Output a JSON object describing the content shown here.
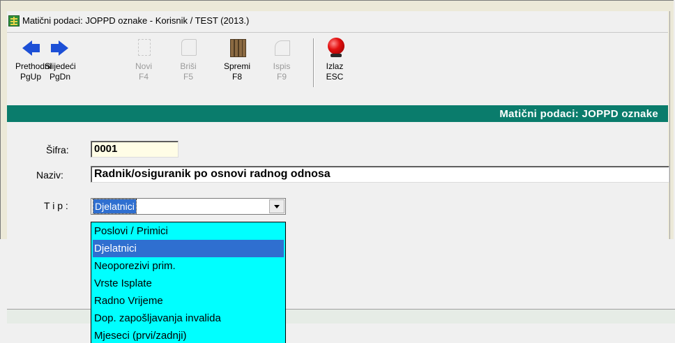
{
  "window": {
    "title": "Matični podaci: JOPPD oznake - Korisnik / TEST (2013.)"
  },
  "toolbar": {
    "buttons": [
      {
        "name": "prev",
        "line1": "Prethodni",
        "line2": "PgUp",
        "icon": "arrow-left-icon",
        "enabled": true
      },
      {
        "name": "next",
        "line1": "Slijedeći",
        "line2": "PgDn",
        "icon": "arrow-right-icon",
        "enabled": true
      },
      {
        "name": "new",
        "line1": "Novi",
        "line2": "F4",
        "icon": "new-document-icon",
        "enabled": false
      },
      {
        "name": "delete",
        "line1": "Briši",
        "line2": "F5",
        "icon": "delete-icon",
        "enabled": false
      },
      {
        "name": "save",
        "line1": "Spremi",
        "line2": "F8",
        "icon": "save-files-icon",
        "enabled": true
      },
      {
        "name": "print",
        "line1": "Ispis",
        "line2": "F9",
        "icon": "print-icon",
        "enabled": false
      },
      {
        "name": "exit",
        "line1": "Izlaz",
        "line2": "ESC",
        "icon": "exit-ball-icon",
        "enabled": true
      }
    ]
  },
  "header": {
    "title": "Matični podaci: JOPPD oznake",
    "color": "#0a7c6c"
  },
  "form": {
    "sifra_label": "Šifra:",
    "sifra_value": "0001",
    "naziv_label": "Naziv:",
    "naziv_value": "Radnik/osiguranik po osnovi radnog odnosa",
    "tip_label": "T i p :",
    "tip_value": "Djelatnici"
  },
  "dropdown": {
    "background": "#00ffff",
    "selected_index": 1,
    "options": [
      "Poslovi / Primici",
      "Djelatnici",
      "Neoporezivi prim.",
      "Vrste Isplate",
      "Radno Vrijeme",
      "Dop. zapošljavanja invalida",
      "Mjeseci (prvi/zadnji)"
    ]
  }
}
